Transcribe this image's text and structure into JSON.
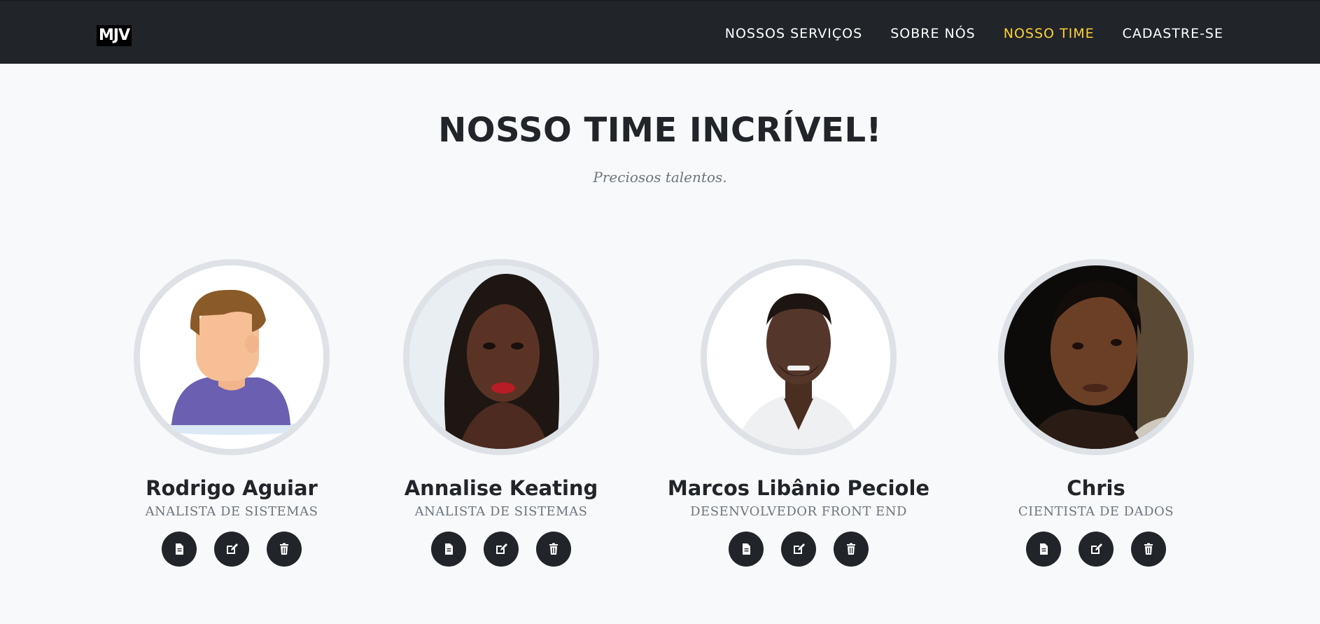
{
  "brand": {
    "logo": "MJV"
  },
  "nav": {
    "items": [
      {
        "label": "NOSSOS SERVIÇOS",
        "active": false
      },
      {
        "label": "SOBRE NÓS",
        "active": false
      },
      {
        "label": "NOSSO TIME",
        "active": true
      },
      {
        "label": "CADASTRE-SE",
        "active": false
      }
    ]
  },
  "section": {
    "title": "NOSSO TIME INCRÍVEL!",
    "subtitle": "Preciosos talentos."
  },
  "team": [
    {
      "name": "Rodrigo Aguiar",
      "role": "ANALISTA DE SISTEMAS"
    },
    {
      "name": "Annalise Keating",
      "role": "ANALISTA DE SISTEMAS"
    },
    {
      "name": "Marcos Libânio Peciole",
      "role": "DESENVOLVEDOR FRONT END"
    },
    {
      "name": "Chris",
      "role": "CIENTISTA DE DADOS"
    }
  ],
  "colors": {
    "navbar": "#212529",
    "active_nav": "#fed136",
    "button": "#212529",
    "background": "#f8f9fa"
  },
  "icons": [
    "file-icon",
    "edit-icon",
    "trash-icon"
  ]
}
